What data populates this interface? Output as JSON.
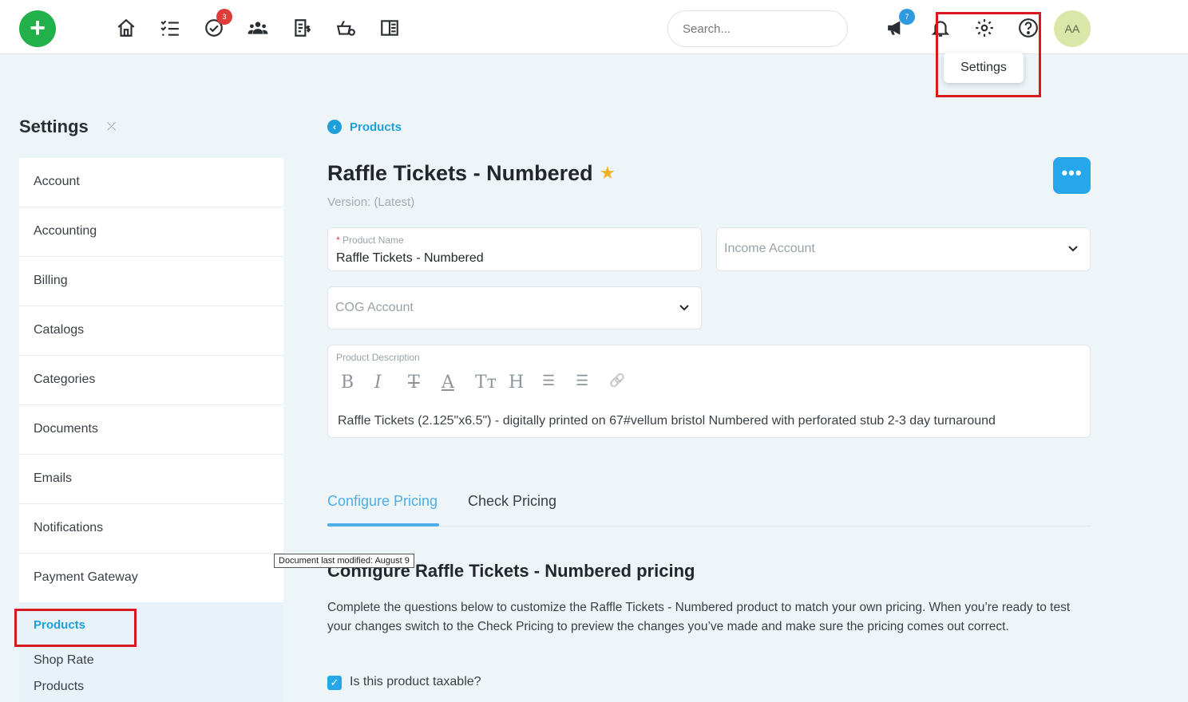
{
  "topbar": {
    "add_icon": "plus-icon",
    "tasks_badge": "3",
    "announcements_badge": "7",
    "search_placeholder": "Search...",
    "avatar_initials": "AA",
    "settings_tooltip": "Settings"
  },
  "sidebar": {
    "title": "Settings",
    "collapse_icon": "collapse-icon",
    "items": [
      {
        "label": "Account"
      },
      {
        "label": "Accounting"
      },
      {
        "label": "Billing"
      },
      {
        "label": "Catalogs"
      },
      {
        "label": "Categories"
      },
      {
        "label": "Documents"
      },
      {
        "label": "Emails"
      },
      {
        "label": "Notifications"
      },
      {
        "label": "Payment Gateway"
      }
    ],
    "active_section": "Products",
    "sub_items": [
      {
        "label": "Shop Rate"
      },
      {
        "label": "Products"
      }
    ]
  },
  "doc_tooltip": "Document last modified: August 9",
  "main": {
    "back_label": "Products",
    "product_title": "Raffle Tickets - Numbered",
    "more_label": "•••",
    "version": "Version: (Latest)",
    "product_name_label": "Product Name",
    "product_name_value": "Raffle Tickets - Numbered",
    "income_account_placeholder": "Income Account",
    "cog_account_placeholder": "COG Account",
    "description_label": "Product Description",
    "description_text": "Raffle Tickets (2.125\"x6.5\") - digitally printed on 67#vellum bristol Numbered with perforated stub 2-3 day turnaround",
    "toolbar": [
      "B",
      "I",
      "T",
      "A",
      "Tт",
      "H",
      "☰",
      "☰",
      "🔗"
    ],
    "tabs": [
      {
        "label": "Configure Pricing",
        "active": true
      },
      {
        "label": "Check Pricing",
        "active": false
      }
    ],
    "section_title": "Configure Raffle Tickets - Numbered pricing",
    "section_desc": "Complete the questions below to customize the Raffle Tickets - Numbered product to match your own pricing. When you’re ready to test your changes switch to the Check Pricing to preview the changes you’ve made and make sure the pricing comes out correct.",
    "taxable_label": "Is this product taxable?",
    "taxable_checked": true
  },
  "colors": {
    "accent": "#1e9fdc",
    "add_button": "#22b04b",
    "highlight": "#d9191f"
  }
}
